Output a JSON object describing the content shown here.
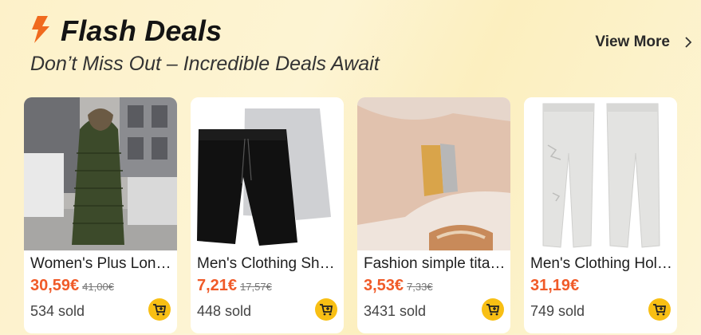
{
  "header": {
    "title": "Flash Deals",
    "subtitle": "Don’t Miss Out – Incredible Deals Await",
    "view_more": "View More",
    "icons": {
      "title": "lightning-bolt-icon",
      "view_more": "chevron-right-icon"
    }
  },
  "products": [
    {
      "name": "Women's Plus Long Puffer Coat",
      "price": "30,59€",
      "old_price": "41,00€",
      "sold": "534 sold"
    },
    {
      "name": "Men's Clothing Shorts",
      "price": "7,21€",
      "old_price": "17,57€",
      "sold": "448 sold"
    },
    {
      "name": "Fashion simple titanium bracelet",
      "price": "3,53€",
      "old_price": "7,33€",
      "sold": "3431 sold"
    },
    {
      "name": "Men's Clothing Hole Jeans",
      "price": "31,19€",
      "old_price": "",
      "sold": "749 sold"
    }
  ],
  "colors": {
    "accent": "#f05a28",
    "cart": "#f8bf14",
    "bolt": "#f06a1e"
  }
}
